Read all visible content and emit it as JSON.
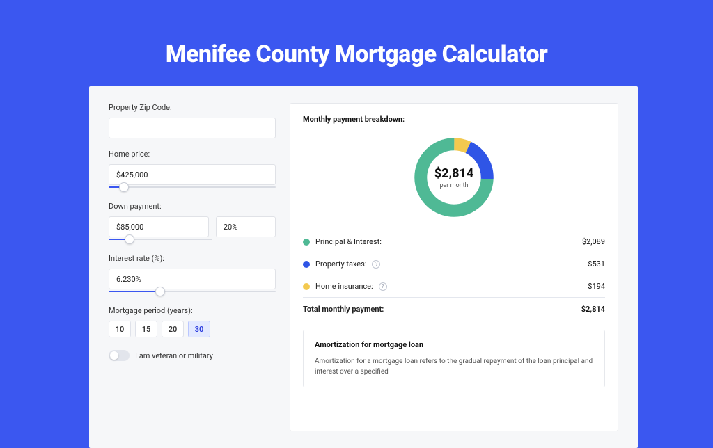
{
  "title": "Menifee County Mortgage Calculator",
  "labels": {
    "zip": "Property Zip Code:",
    "home_price": "Home price:",
    "down_payment": "Down payment:",
    "interest_rate": "Interest rate (%):",
    "period": "Mortgage period (years):",
    "veteran": "I am veteran or military"
  },
  "inputs": {
    "zip": "",
    "home_price": "$425,000",
    "down_payment_amount": "$85,000",
    "down_payment_pct": "20%",
    "interest_rate": "6.230%"
  },
  "sliders": {
    "home_price_pct": 9,
    "down_payment_pct": 20,
    "interest_rate_pct": 31
  },
  "periods": [
    "10",
    "15",
    "20",
    "30"
  ],
  "period_active_index": 3,
  "breakdown": {
    "heading": "Monthly payment breakdown:",
    "total_amount": "$2,814",
    "per_month": "per month",
    "rows": [
      {
        "label": "Principal & Interest:",
        "color": "#4fb995",
        "value": "$2,089",
        "info": false
      },
      {
        "label": "Property taxes:",
        "color": "#2f55e6",
        "value": "$531",
        "info": true
      },
      {
        "label": "Home insurance:",
        "color": "#f3c94f",
        "value": "$194",
        "info": true
      }
    ],
    "total_row": {
      "label": "Total monthly payment:",
      "value": "$2,814"
    }
  },
  "chart_data": {
    "type": "pie",
    "title": "Monthly payment breakdown",
    "categories": [
      "Principal & Interest",
      "Property taxes",
      "Home insurance"
    ],
    "values": [
      2089,
      531,
      194
    ],
    "colors": [
      "#4fb995",
      "#2f55e6",
      "#f3c94f"
    ],
    "center_label": "$2,814",
    "center_sub": "per month"
  },
  "amortization": {
    "title": "Amortization for mortgage loan",
    "text": "Amortization for a mortgage loan refers to the gradual repayment of the loan principal and interest over a specified"
  }
}
